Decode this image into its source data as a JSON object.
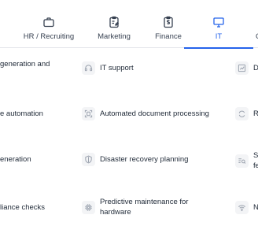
{
  "tabs": [
    {
      "label": "HR / Recruiting",
      "icon": "briefcase-icon"
    },
    {
      "label": "Marketing",
      "icon": "clipboard-edit-icon"
    },
    {
      "label": "Finance",
      "icon": "clipboard-dollar-icon"
    },
    {
      "label": "IT",
      "icon": "monitor-icon",
      "active": true
    },
    {
      "label": "",
      "icon": "partial-tab"
    }
  ],
  "left_column": {
    "row1_line1": "generation and",
    "row2": "e automation",
    "row3": "eneration",
    "row4": "liance checks"
  },
  "middle_column": {
    "row1": "IT support",
    "row2": "Automated document processing",
    "row3": "Disaster recovery planning",
    "row4_line1": "Predictive maintenance for",
    "row4_line2": "hardware"
  },
  "right_column": {
    "row1": "D",
    "row2": "R",
    "row3_line1": "S",
    "row3_line2": "fe",
    "row4": "N"
  },
  "colors": {
    "accent": "#2563eb",
    "text": "#1f2937",
    "icon_bg": "#f3f4f6",
    "icon_fg": "#9ca3af",
    "divider": "#e5e7eb"
  }
}
